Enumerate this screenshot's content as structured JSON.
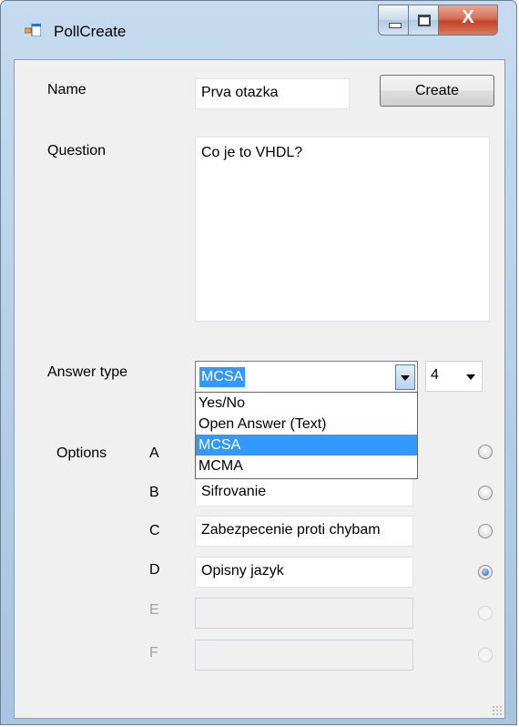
{
  "window": {
    "title": "PollCreate",
    "close_glyph": "X",
    "icon": "form-app-icon"
  },
  "form": {
    "name_label": "Name",
    "name_value": "Prva otazka",
    "create_label": "Create",
    "question_label": "Question",
    "question_value": "Co je to VHDL?",
    "answer_type_label": "Answer type",
    "answer_type_value": "MCSA",
    "answer_type_options": [
      "Yes/No",
      "Open Answer (Text)",
      "MCSA",
      "MCMA"
    ],
    "option_count_value": "4",
    "options_label": "Options",
    "options": [
      {
        "letter": "A",
        "value": "",
        "enabled": true,
        "selected": false
      },
      {
        "letter": "B",
        "value": "Sifrovanie",
        "enabled": true,
        "selected": false
      },
      {
        "letter": "C",
        "value": "Zabezpecenie proti chybam",
        "enabled": true,
        "selected": false
      },
      {
        "letter": "D",
        "value": "Opisny jazyk",
        "enabled": true,
        "selected": true
      },
      {
        "letter": "E",
        "value": "",
        "enabled": false,
        "selected": false
      },
      {
        "letter": "F",
        "value": "",
        "enabled": false,
        "selected": false
      }
    ]
  }
}
